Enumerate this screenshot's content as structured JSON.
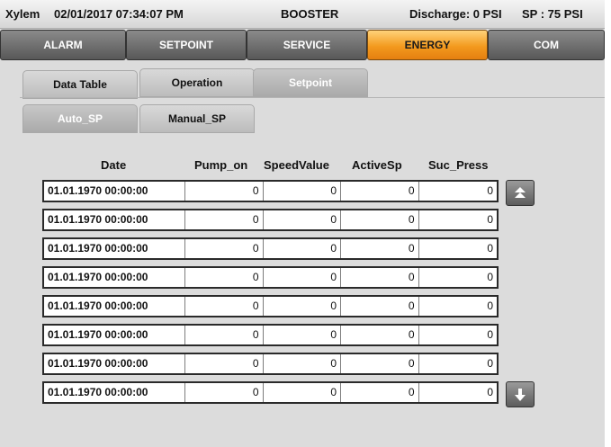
{
  "header": {
    "brand": "Xylem",
    "datetime": "02/01/2017 07:34:07 PM",
    "mode": "BOOSTER",
    "discharge": "Discharge: 0 PSI",
    "setpoint": "SP : 75 PSI"
  },
  "main_tabs": [
    {
      "label": "ALARM"
    },
    {
      "label": "SETPOINT"
    },
    {
      "label": "SERVICE"
    },
    {
      "label": "ENERGY"
    },
    {
      "label": "COM"
    }
  ],
  "active_main_tab": "ENERGY",
  "sub_tabs": [
    {
      "label": "Data Table"
    },
    {
      "label": "Operation"
    },
    {
      "label": "Setpoint"
    }
  ],
  "mode_tabs": [
    {
      "label": "Auto_SP"
    },
    {
      "label": "Manual_SP"
    }
  ],
  "table": {
    "columns": [
      "Date",
      "Pump_on",
      "SpeedValue",
      "ActiveSp",
      "Suc_Press"
    ],
    "rows": [
      [
        "01.01.1970 00:00:00",
        "0",
        "0",
        "0",
        "0"
      ],
      [
        "01.01.1970 00:00:00",
        "0",
        "0",
        "0",
        "0"
      ],
      [
        "01.01.1970 00:00:00",
        "0",
        "0",
        "0",
        "0"
      ],
      [
        "01.01.1970 00:00:00",
        "0",
        "0",
        "0",
        "0"
      ],
      [
        "01.01.1970 00:00:00",
        "0",
        "0",
        "0",
        "0"
      ],
      [
        "01.01.1970 00:00:00",
        "0",
        "0",
        "0",
        "0"
      ],
      [
        "01.01.1970 00:00:00",
        "0",
        "0",
        "0",
        "0"
      ],
      [
        "01.01.1970 00:00:00",
        "0",
        "0",
        "0",
        "0"
      ]
    ]
  },
  "icons": {
    "scroll_up": "scroll-up-icon",
    "scroll_down": "scroll-down-icon"
  },
  "colors": {
    "active_tab": "#f39a1e",
    "inactive_tab": "#6e6e6e",
    "background": "#dcdcdc"
  }
}
